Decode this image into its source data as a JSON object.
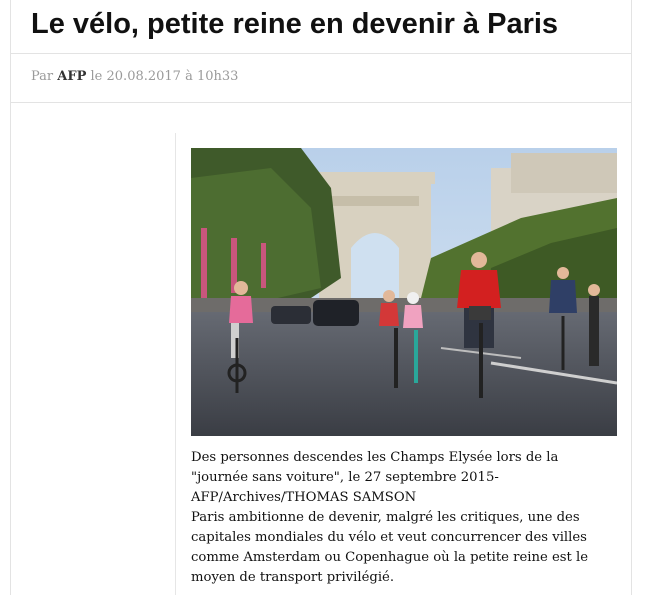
{
  "article": {
    "title": "Le vélo, petite reine en devenir à Paris",
    "byline": {
      "prefix": "Par",
      "author": "AFP",
      "date_prefix": "le",
      "date": "20.08.2017 à 10h33"
    },
    "image": {
      "alt": "Cyclistes sur les Champs Elysées, Arc de Triomphe",
      "icon": "photo-icon"
    },
    "caption": "Des personnes descendes les Champs Elysée lors de la \"journée sans voiture\", le 27 septembre 2015- AFP/Archives/THOMAS SAMSON",
    "lead": "Paris ambitionne de devenir, malgré les critiques, une des capitales mondiales du vélo et veut concurrencer des villes comme Amsterdam ou Copenhague où la petite reine est le moyen de transport privilégié."
  },
  "colors": {
    "sky": "#c9dcef",
    "road": "#4a4e57",
    "trees": "#3f5a2a",
    "jacket_red": "#d32020"
  }
}
